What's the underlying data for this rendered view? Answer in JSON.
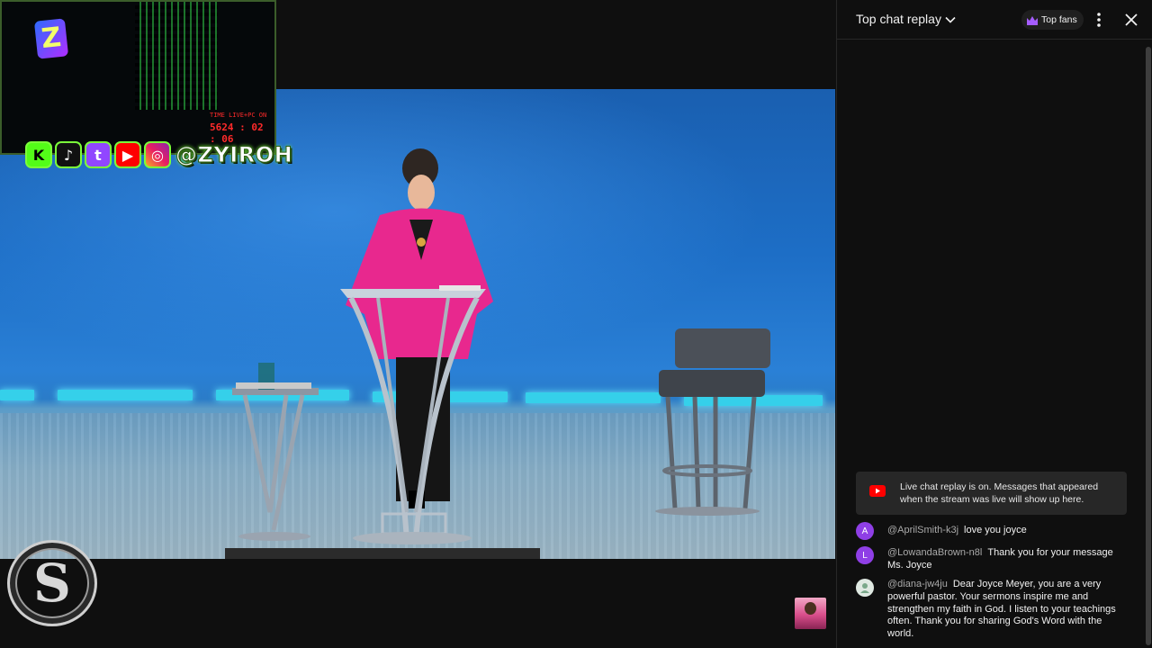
{
  "overlay": {
    "timer_label": "TIME LIVE+PC ON",
    "timer_value": "5624 : 02 : 06",
    "handle": "@ZYIROH",
    "webcam_logo": "Z",
    "corner_logo": "S",
    "social_icons": [
      "kick-icon",
      "tiktok-icon",
      "twitch-icon",
      "youtube-icon",
      "instagram-icon"
    ],
    "social_glyphs": [
      "K",
      "♪",
      "t",
      "▶",
      "◎"
    ]
  },
  "chat": {
    "title": "Top chat replay",
    "top_fans_label": "Top fans",
    "notice": "Live chat replay is on. Messages that appeared when the stream was live will show up here.",
    "messages": [
      {
        "avatar": "A",
        "avatar_color": "#8f3fe6",
        "author": "@AprilSmith-k3j",
        "text": "love you joyce"
      },
      {
        "avatar": "L",
        "avatar_color": "#8f3fe6",
        "author": "@LowandaBrown-n8l",
        "text": "Thank you for your message Ms. Joyce"
      },
      {
        "avatar": "",
        "avatar_color": "#dfe9e2",
        "author": "@diana-jw4ju",
        "text": "Dear Joyce Meyer, you are a very powerful pastor. Your sermons inspire me and strengthen my faith in God. I listen to your teachings often. Thank you for sharing God's Word with the world."
      }
    ]
  },
  "colors": {
    "accent_purple": "#a55cff",
    "youtube_red": "#ff0000",
    "panel_bg": "#0f0f0f"
  }
}
